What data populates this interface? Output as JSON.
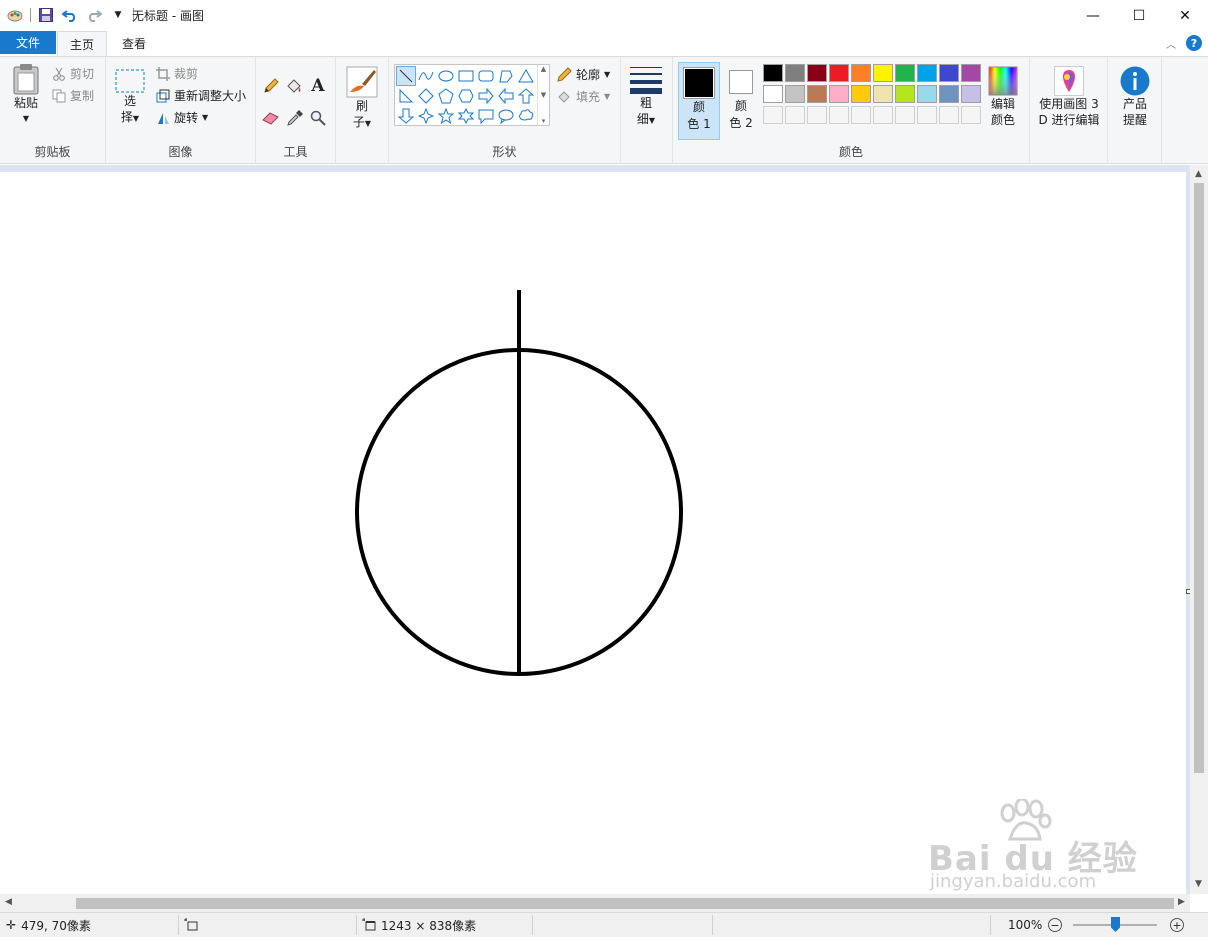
{
  "window": {
    "title": "无标题 - 画图",
    "controls": [
      "minimize",
      "maximize",
      "close"
    ]
  },
  "tabs": {
    "file": "文件",
    "home": "主页",
    "view": "查看",
    "active": "主页"
  },
  "clipboard": {
    "paste": "粘贴",
    "cut": "剪切",
    "copy": "复制",
    "group": "剪贴板"
  },
  "image": {
    "select_line1": "选",
    "select_line2": "择",
    "crop": "裁剪",
    "resize": "重新调整大小",
    "rotate": "旋转",
    "group": "图像"
  },
  "tools": {
    "group": "工具",
    "items": [
      "pencil-icon",
      "fill-icon",
      "text-icon",
      "eraser-icon",
      "color-picker-icon",
      "magnifier-icon"
    ]
  },
  "brushes": {
    "line1": "刷",
    "line2": "子"
  },
  "shapes": {
    "group": "形状",
    "outline": "轮廓",
    "fill": "填充",
    "selected": "line"
  },
  "size": {
    "line1": "粗",
    "line2": "细"
  },
  "colors": {
    "group": "颜色",
    "color1_line1": "颜",
    "color1_line2": "色 1",
    "color2_line1": "颜",
    "color2_line2": "色 2",
    "color1_value": "#000000",
    "color2_value": "#ffffff",
    "edit_line1": "编辑",
    "edit_line2": "颜色",
    "palette_row1": [
      "#000000",
      "#7f7f7f",
      "#880015",
      "#ed1c24",
      "#ff7f27",
      "#fff200",
      "#22b14c",
      "#00a2e8",
      "#3f48cc",
      "#a349a4"
    ],
    "palette_row2": [
      "#ffffff",
      "#c3c3c3",
      "#b97a57",
      "#ffaec9",
      "#ffc90e",
      "#efe4b0",
      "#b5e61d",
      "#99d9ea",
      "#7092be",
      "#c8bfe7"
    ],
    "palette_row3": [
      "#f5f5f5",
      "#f5f5f5",
      "#f5f5f5",
      "#f5f5f5",
      "#f5f5f5",
      "#f5f5f5",
      "#f5f5f5",
      "#f5f5f5",
      "#f5f5f5",
      "#f5f5f5"
    ]
  },
  "paint3d": {
    "line1": "使用画图 3",
    "line2": "D 进行编辑"
  },
  "product": {
    "line1": "产品",
    "line2": "提醒"
  },
  "statusbar": {
    "cursor_pos": "479, 70像素",
    "canvas_size": "1243 × 838像素",
    "zoom": "100%",
    "zoom_fraction": 0.5
  },
  "watermark": {
    "brand": "Bai du 经验",
    "url": "jingyan.baidu.com"
  }
}
